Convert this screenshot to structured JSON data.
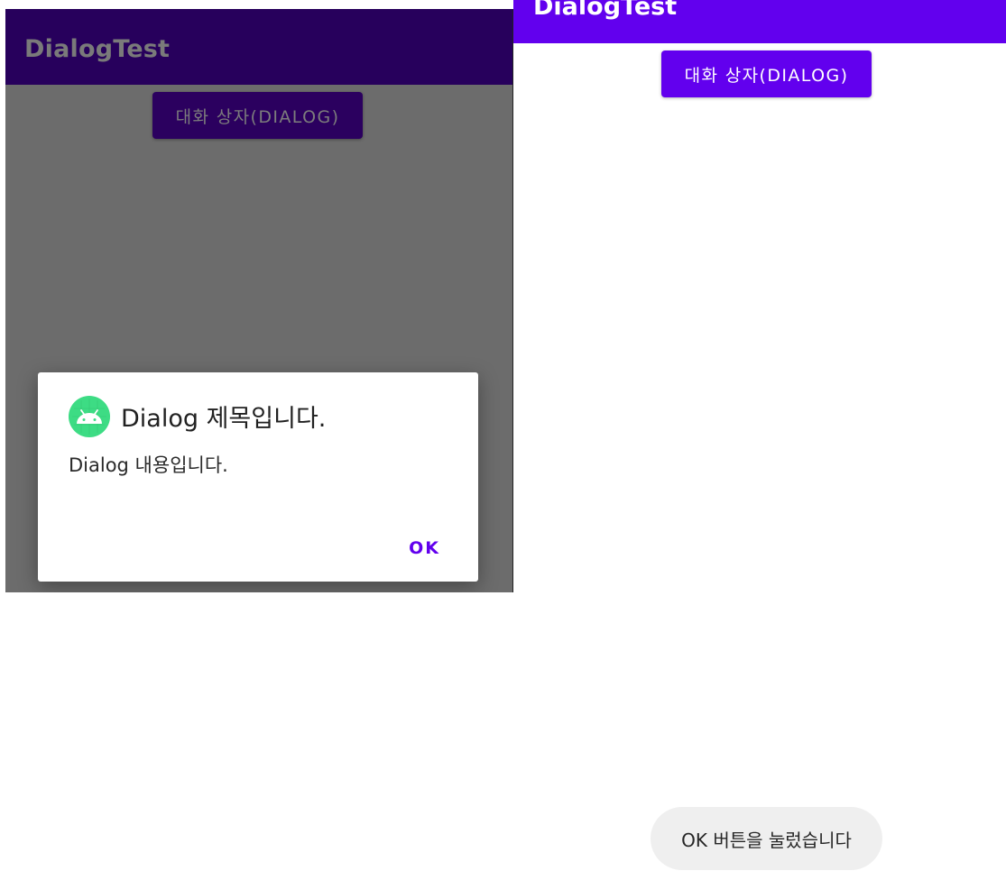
{
  "left_screen": {
    "app_title": "DialogTest",
    "button_label": "대화 상자(DIALOG)",
    "dialog": {
      "icon": "android-icon",
      "title": "Dialog 제목입니다.",
      "message": "Dialog 내용입니다.",
      "ok_label": "OK"
    }
  },
  "right_screen": {
    "app_title": "DialogTest",
    "button_label": "대화 상자(DIALOG)",
    "toast_message": "OK 버튼을 눌렀습니다"
  },
  "colors": {
    "primary": "#6200ee",
    "primary_dimmed": "#27005c",
    "scrim": "#6c6c6c",
    "toast_bg": "#efefef"
  }
}
